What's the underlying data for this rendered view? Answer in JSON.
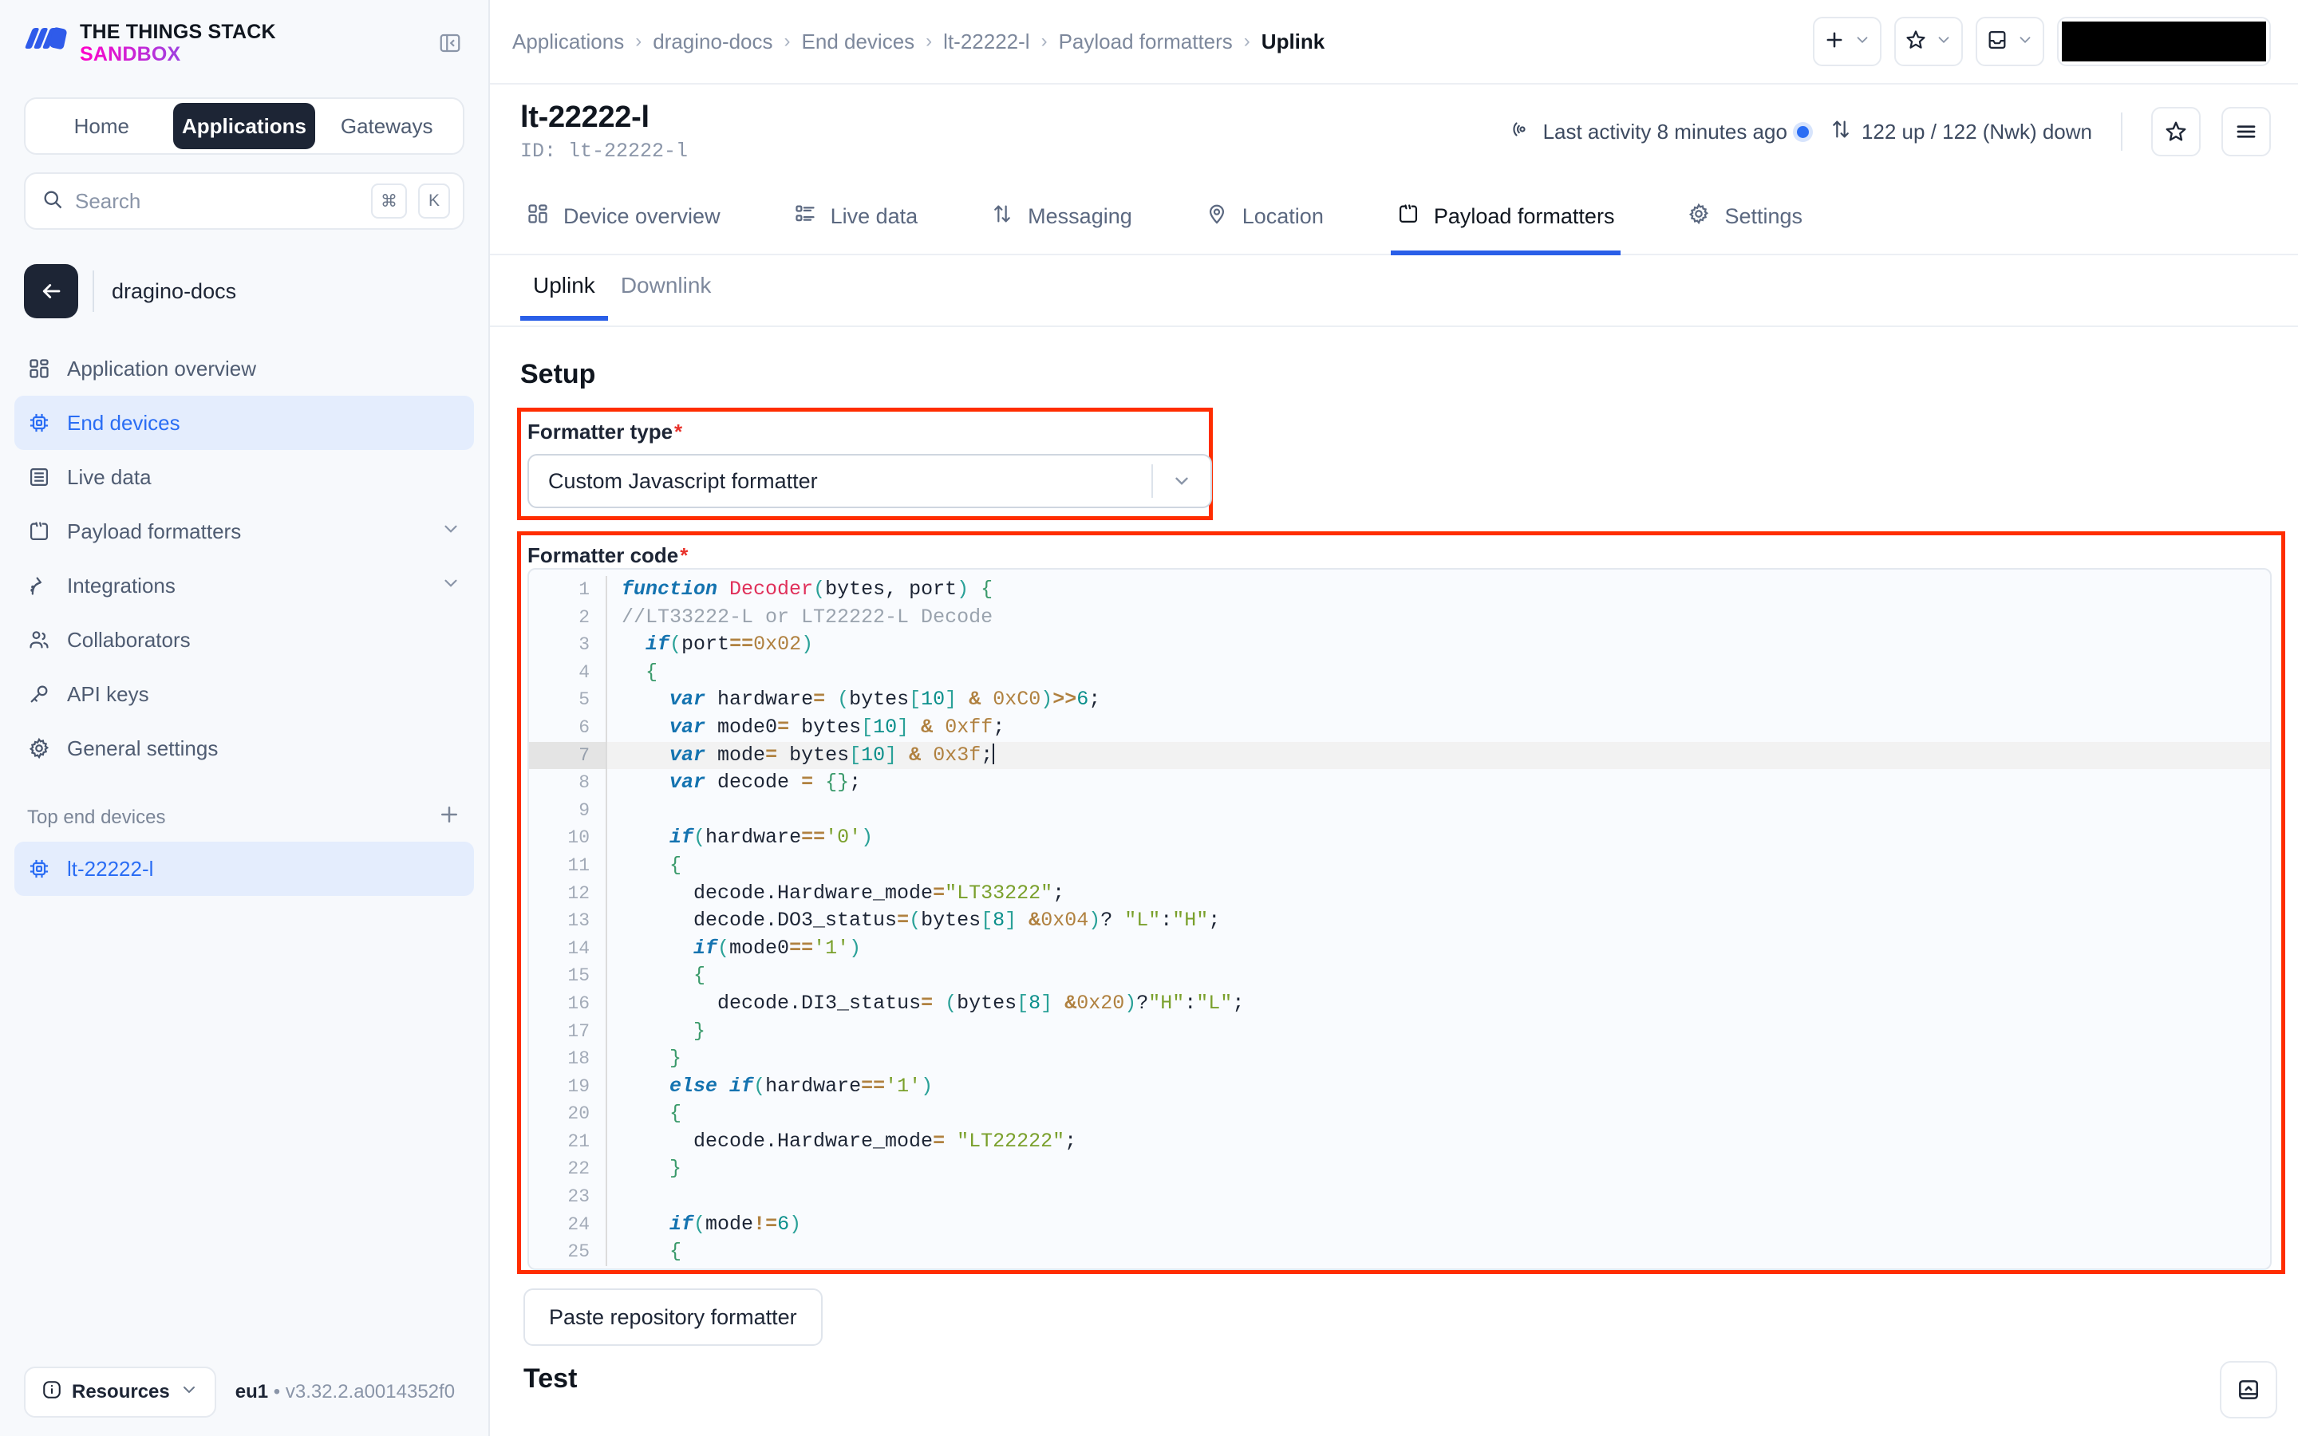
{
  "brand": {
    "line1": "THE THINGS STACK",
    "line2": "SANDBOX"
  },
  "sidebar": {
    "segments": [
      {
        "label": "Home",
        "active": false
      },
      {
        "label": "Applications",
        "active": true
      },
      {
        "label": "Gateways",
        "active": false
      }
    ],
    "search": {
      "placeholder": "Search",
      "value": "",
      "kbd1": "⌘",
      "kbd2": "K"
    },
    "application": "dragino-docs",
    "nav": [
      {
        "label": "Application overview",
        "icon": "overview-icon",
        "active": false,
        "expandable": false
      },
      {
        "label": "End devices",
        "icon": "chip-icon",
        "active": true,
        "expandable": false
      },
      {
        "label": "Live data",
        "icon": "list-icon",
        "active": false,
        "expandable": false
      },
      {
        "label": "Payload formatters",
        "icon": "code-icon",
        "active": false,
        "expandable": true
      },
      {
        "label": "Integrations",
        "icon": "integrations-icon",
        "active": false,
        "expandable": true
      },
      {
        "label": "Collaborators",
        "icon": "users-icon",
        "active": false,
        "expandable": false
      },
      {
        "label": "API keys",
        "icon": "key-icon",
        "active": false,
        "expandable": false
      },
      {
        "label": "General settings",
        "icon": "gear-icon",
        "active": false,
        "expandable": false
      }
    ],
    "section_title": "Top end devices",
    "devices": [
      {
        "label": "lt-22222-l",
        "active": true
      }
    ],
    "footer": {
      "resources": "Resources",
      "cluster": "eu1",
      "separator": "•",
      "version": "v3.32.2.a0014352f0"
    }
  },
  "topbar": {
    "breadcrumbs": [
      {
        "label": "Applications",
        "current": false
      },
      {
        "label": "dragino-docs",
        "current": false
      },
      {
        "label": "End devices",
        "current": false
      },
      {
        "label": "lt-22222-l",
        "current": false
      },
      {
        "label": "Payload formatters",
        "current": false
      },
      {
        "label": "Uplink",
        "current": true
      }
    ],
    "separator": "›",
    "actions": [
      {
        "name": "add-menu",
        "icon": "plus-icon"
      },
      {
        "name": "bookmarks-menu",
        "icon": "star-icon"
      },
      {
        "name": "notifications-menu",
        "icon": "inbox-icon"
      }
    ]
  },
  "device": {
    "title": "lt-22222-l",
    "id_label": "ID: lt-22222-l",
    "last_activity": "Last activity 8 minutes ago",
    "traffic": "122 up / 122 (Nwk) down"
  },
  "tabs": [
    {
      "label": "Device overview",
      "icon": "overview-icon",
      "active": false
    },
    {
      "label": "Live data",
      "icon": "livedata-icon",
      "active": false
    },
    {
      "label": "Messaging",
      "icon": "messaging-icon",
      "active": false
    },
    {
      "label": "Location",
      "icon": "location-icon",
      "active": false
    },
    {
      "label": "Payload formatters",
      "icon": "code-icon",
      "active": true
    },
    {
      "label": "Settings",
      "icon": "gear-icon",
      "active": false
    }
  ],
  "subtabs": [
    {
      "label": "Uplink",
      "active": true
    },
    {
      "label": "Downlink",
      "active": false
    }
  ],
  "setup": {
    "heading": "Setup",
    "formatter_type": {
      "label": "Formatter type",
      "required_marker": "*",
      "value": "Custom Javascript formatter"
    },
    "formatter_code": {
      "label": "Formatter code",
      "required_marker": "*"
    }
  },
  "buttons": {
    "paste_repository": "Paste repository formatter"
  },
  "test": {
    "heading": "Test"
  },
  "colors": {
    "accent": "#2a5fe8",
    "annotation": "#ff2d00",
    "sidebar_bg": "#f7f9fc",
    "active_nav": "#2a6df4"
  },
  "code_lines": [
    {
      "n": "1",
      "text": "function Decoder(bytes, port) {"
    },
    {
      "n": "2",
      "text": "//LT33222-L or LT22222-L Decode"
    },
    {
      "n": "3",
      "text": "  if(port==0x02)"
    },
    {
      "n": "4",
      "text": "  {"
    },
    {
      "n": "5",
      "text": "    var hardware= (bytes[10] & 0xC0)>>6;"
    },
    {
      "n": "6",
      "text": "    var mode0= bytes[10] & 0xff;"
    },
    {
      "n": "7",
      "text": "    var mode= bytes[10] & 0x3f;",
      "highlight": true
    },
    {
      "n": "8",
      "text": "    var decode = {};"
    },
    {
      "n": "9",
      "text": ""
    },
    {
      "n": "10",
      "text": "    if(hardware=='0')"
    },
    {
      "n": "11",
      "text": "    {"
    },
    {
      "n": "12",
      "text": "      decode.Hardware_mode=\"LT33222\";"
    },
    {
      "n": "13",
      "text": "      decode.DO3_status=(bytes[8] &0x04)? \"L\":\"H\";"
    },
    {
      "n": "14",
      "text": "      if(mode0=='1')"
    },
    {
      "n": "15",
      "text": "      {"
    },
    {
      "n": "16",
      "text": "        decode.DI3_status= (bytes[8] &0x20)?\"H\":\"L\";"
    },
    {
      "n": "17",
      "text": "      }"
    },
    {
      "n": "18",
      "text": "    }"
    },
    {
      "n": "19",
      "text": "    else if(hardware=='1')"
    },
    {
      "n": "20",
      "text": "    {"
    },
    {
      "n": "21",
      "text": "      decode.Hardware_mode= \"LT22222\";"
    },
    {
      "n": "22",
      "text": "    }"
    },
    {
      "n": "23",
      "text": ""
    },
    {
      "n": "24",
      "text": "    if(mode!=6)"
    },
    {
      "n": "25",
      "text": "    {"
    }
  ]
}
